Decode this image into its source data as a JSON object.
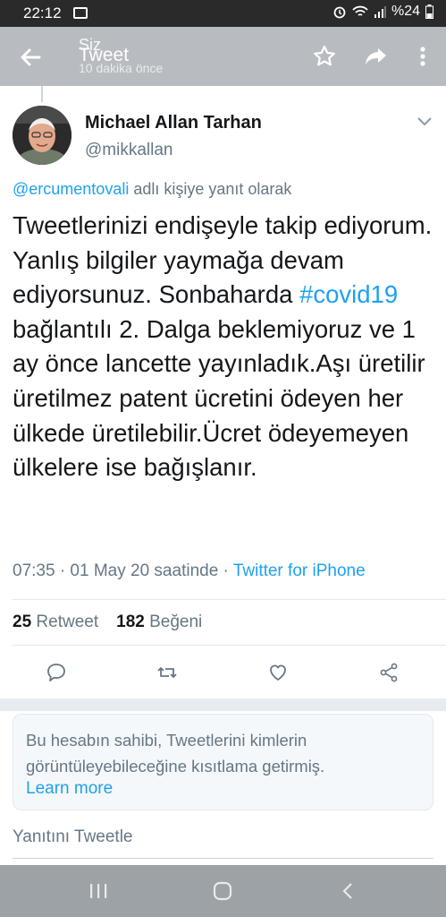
{
  "status_bar": {
    "time": "22:12",
    "battery_text": "%24"
  },
  "app_bar": {
    "title": "Tweet",
    "overlay_label": "Siz",
    "subtitle": "10 dakika önce"
  },
  "tweet": {
    "author_name": "Michael Allan Tarhan",
    "author_handle": "@mikkallan",
    "reply_to_handle": "@ercumentovali",
    "reply_to_suffix": " adlı kişiye yanıt olarak",
    "text_before_hashtag": "Tweetlerinizi endişeyle takip ediyorum. Yanlış bilgiler yaymağa devam ediyorsunuz. Sonbaharda ",
    "hashtag": "#covid19",
    "text_after_hashtag": " bağlantılı 2. Dalga beklemiyoruz ve 1 ay önce lancette yayınladık.Aşı üretilir üretilmez patent ücretini ödeyen her ülkede üretilebilir.Ücret ödeyemeyen ülkelere ise bağışlanır.",
    "timestamp": "07:35 · 01 May 20 saatinde · ",
    "source": "Twitter for iPhone",
    "retweet_count": "25",
    "retweet_label": "Retweet",
    "like_count": "182",
    "like_label": "Beğeni"
  },
  "notice": {
    "text": "Bu hesabın sahibi, Tweetlerini kimlerin görüntüleyebileceğine kısıtlama getirmiş.",
    "link": "Learn more"
  },
  "reply": {
    "placeholder": "Yanıtını Tweetle"
  },
  "colors": {
    "accent": "#1da1f2",
    "app_bar": "#b8bcc0",
    "status_bar": "#2a2a2a",
    "nav_bar": "#9da2a6"
  },
  "icons": {
    "back": "arrow-left-icon",
    "star": "star-icon",
    "share": "share-arrow-icon",
    "more": "more-vertical-icon",
    "reply": "comment-icon",
    "retweet": "retweet-icon",
    "like": "heart-icon",
    "share_action": "share-nodes-icon"
  }
}
